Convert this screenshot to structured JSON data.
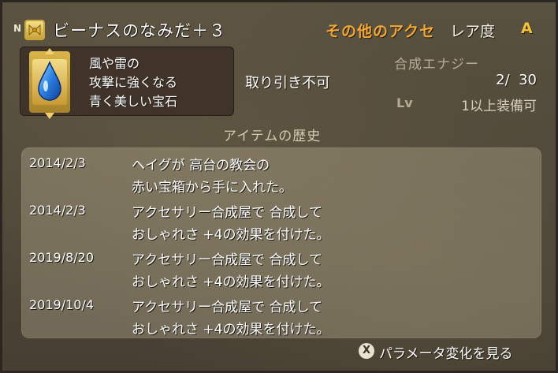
{
  "item": {
    "badge": "N",
    "name": "ビーナスのなみだ＋３",
    "category": "その他のアクセ",
    "rarity_label": "レア度",
    "rarity_value": "A",
    "description": [
      "風や雷の",
      "攻撃に強くなる",
      "青く美しい宝石"
    ],
    "trade_status": "取り引き不可",
    "synthesis_label": "合成エナジー",
    "synthesis_value": "2/  30",
    "level_label": "Lv",
    "level_text": "1以上装備可",
    "icon": "water-drop-icon"
  },
  "history": {
    "title": "アイテムの歴史",
    "entries": [
      {
        "date": "2014/2/3",
        "lines": [
          "ヘイグが 高台の教会の",
          "赤い宝箱から手に入れた。"
        ]
      },
      {
        "date": "2014/2/3",
        "lines": [
          "アクセサリー合成屋で 合成して",
          "おしゃれさ +4の効果を付けた。"
        ]
      },
      {
        "date": "2019/8/20",
        "lines": [
          "アクセサリー合成屋で 合成して",
          "おしゃれさ +4の効果を付けた。"
        ]
      },
      {
        "date": "2019/10/4",
        "lines": [
          "アクセサリー合成屋で 合成して",
          "おしゃれさ +4の効果を付けた。"
        ]
      }
    ]
  },
  "footer": {
    "button": "X",
    "label": "パラメータ変化を見る"
  },
  "colors": {
    "category": "#f0a83a",
    "rarity": "#f0c23a",
    "drop": "#2a7fe0"
  }
}
